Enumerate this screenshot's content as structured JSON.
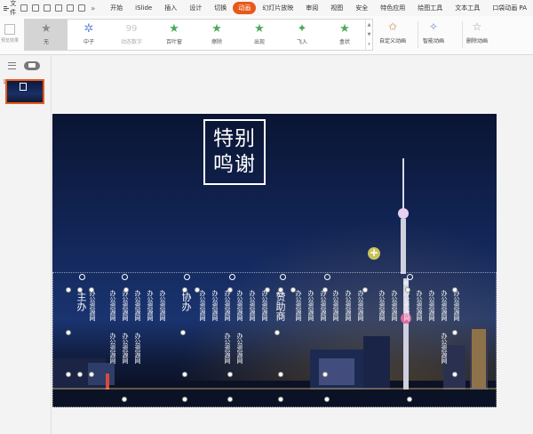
{
  "menubar": {
    "file_label": "文件",
    "more_label": "»",
    "tabs": [
      "开始",
      "iSlide",
      "插入",
      "设计",
      "切换",
      "动画",
      "幻灯片放映",
      "审阅",
      "视图",
      "安全",
      "特色应用",
      "绘图工具",
      "文本工具",
      "口袋动画 PA"
    ],
    "active_tab": "动画"
  },
  "ribbon": {
    "preview_label": "预览效果",
    "gallery": [
      {
        "label": "无",
        "icon": "star-gray-icon"
      },
      {
        "label": "中子",
        "icon": "neutron-icon"
      },
      {
        "label": "动态数字",
        "icon": "dynamic-number-icon"
      },
      {
        "label": "百叶窗",
        "icon": "blinds-star-icon"
      },
      {
        "label": "擦除",
        "icon": "wipe-star-icon"
      },
      {
        "label": "出现",
        "icon": "appear-star-icon"
      },
      {
        "label": "飞入",
        "icon": "fly-in-star-icon"
      },
      {
        "label": "盒状",
        "icon": "box-star-icon"
      }
    ],
    "custom_animation": "自定义动画",
    "smart_animation": "智能动画",
    "delete_animation": "删除动画"
  },
  "thumbnails": {
    "slide_number": "1"
  },
  "slide": {
    "title_line1": "特别",
    "title_line2": "鸣谢",
    "group_host": "主办",
    "group_co": "协办",
    "group_sponsor": "赞助商",
    "entry_text": "办公资源网",
    "colors": {
      "accent": "#e8591a",
      "sky_top": "#0a1533",
      "sky_mid": "#1a3470"
    }
  }
}
